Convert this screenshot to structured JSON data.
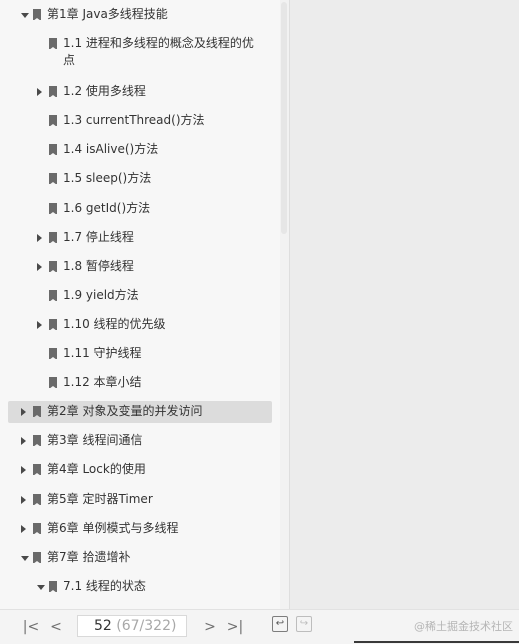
{
  "toc": {
    "items": [
      {
        "text": "第1章 Java多线程技能",
        "expander": "down",
        "level": 0
      },
      {
        "text": "1.1 进程和多线程的概念及线程的优",
        "text2": "点",
        "expander": "none",
        "level": 1
      },
      {
        "text": "1.2 使用多线程",
        "expander": "right",
        "level": 1
      },
      {
        "text": "1.3 currentThread()方法",
        "expander": "none",
        "level": 1
      },
      {
        "text": "1.4 isAlive()方法",
        "expander": "none",
        "level": 1
      },
      {
        "text": "1.5 sleep()方法",
        "expander": "none",
        "level": 1
      },
      {
        "text": "1.6 getId()方法",
        "expander": "none",
        "level": 1
      },
      {
        "text": "1.7 停止线程",
        "expander": "right",
        "level": 1
      },
      {
        "text": "1.8 暂停线程",
        "expander": "right",
        "level": 1
      },
      {
        "text": "1.9 yield方法",
        "expander": "none",
        "level": 1
      },
      {
        "text": "1.10 线程的优先级",
        "expander": "right",
        "level": 1
      },
      {
        "text": "1.11 守护线程",
        "expander": "none",
        "level": 1
      },
      {
        "text": "1.12 本章小结",
        "expander": "none",
        "level": 1
      },
      {
        "text": "第2章 对象及变量的并发访问",
        "expander": "right",
        "level": 0,
        "active": true
      },
      {
        "text": "第3章 线程间通信",
        "expander": "right",
        "level": 0
      },
      {
        "text": "第4章 Lock的使用",
        "expander": "right",
        "level": 0
      },
      {
        "text": "第5章 定时器Timer",
        "expander": "right",
        "level": 0
      },
      {
        "text": "第6章 单例模式与多线程",
        "expander": "right",
        "level": 0
      },
      {
        "text": "第7章 拾遗增补",
        "expander": "down",
        "level": 0
      },
      {
        "text": "7.1 线程的状态",
        "expander": "down",
        "level": 1
      }
    ]
  },
  "pager": {
    "current_page": "52",
    "page_info": "(67/322)",
    "first_label": "|<",
    "prev_label": "<",
    "next_label": ">",
    "last_label": ">|"
  },
  "watermark": "@稀土掘金技术社区"
}
